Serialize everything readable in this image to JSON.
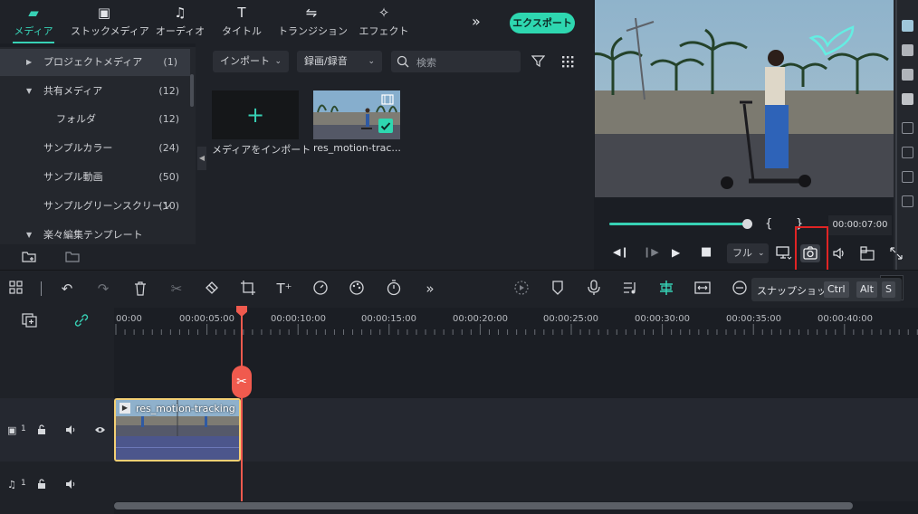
{
  "nav": {
    "tabs": [
      {
        "label": "メディア",
        "icon": "folder-icon",
        "glyph": "▰"
      },
      {
        "label": "ストックメディア",
        "icon": "stock-media-icon",
        "glyph": "▣"
      },
      {
        "label": "オーディオ",
        "icon": "music-note-icon",
        "glyph": "♫"
      },
      {
        "label": "タイトル",
        "icon": "title-icon",
        "glyph": "T"
      },
      {
        "label": "トランジション",
        "icon": "transition-icon",
        "glyph": "⇋"
      },
      {
        "label": "エフェクト",
        "icon": "effect-icon",
        "glyph": "✧"
      }
    ],
    "more": "»",
    "export": "エクスポート"
  },
  "sidebar": {
    "items": [
      {
        "label": "プロジェクトメディア",
        "count": "(1)",
        "caret": "▶"
      },
      {
        "label": "共有メディア",
        "count": "(12)",
        "caret": "▼"
      },
      {
        "label": "フォルダ",
        "count": "(12)",
        "caret": ""
      },
      {
        "label": "サンプルカラー",
        "count": "(24)",
        "caret": ""
      },
      {
        "label": "サンプル動画",
        "count": "(50)",
        "caret": ""
      },
      {
        "label": "サンプルグリーンスクリーン",
        "count": "(10)",
        "caret": ""
      },
      {
        "label": "楽々編集テンプレート",
        "count": "",
        "caret": "▼"
      }
    ]
  },
  "media": {
    "import_dropdown": "インポート",
    "record_dropdown": "録画/録音",
    "search_placeholder": "検索",
    "import_tile_label": "メディアをインポート",
    "clip_label": "res_motion-trac..."
  },
  "player": {
    "timecode": "00:00:07:00",
    "quality": "フル",
    "brace_open": "{",
    "brace_close": "}"
  },
  "tooltip": {
    "text": "スナップショット",
    "keys": [
      "Ctrl",
      "Alt",
      "S"
    ]
  },
  "ruler": {
    "labels": [
      "00:00",
      "00:00:05:00",
      "00:00:10:00",
      "00:00:15:00",
      "00:00:20:00",
      "00:00:25:00",
      "00:00:30:00",
      "00:00:35:00",
      "00:00:40:00"
    ]
  },
  "tracks": {
    "video_number": "1",
    "audio_number": "1",
    "clip_name": "res_motion-tracking"
  },
  "colors": {
    "accent": "#37d1b5",
    "playhead": "#f05a4e",
    "highlight": "#e02424",
    "clip_border": "#f3cf74"
  }
}
